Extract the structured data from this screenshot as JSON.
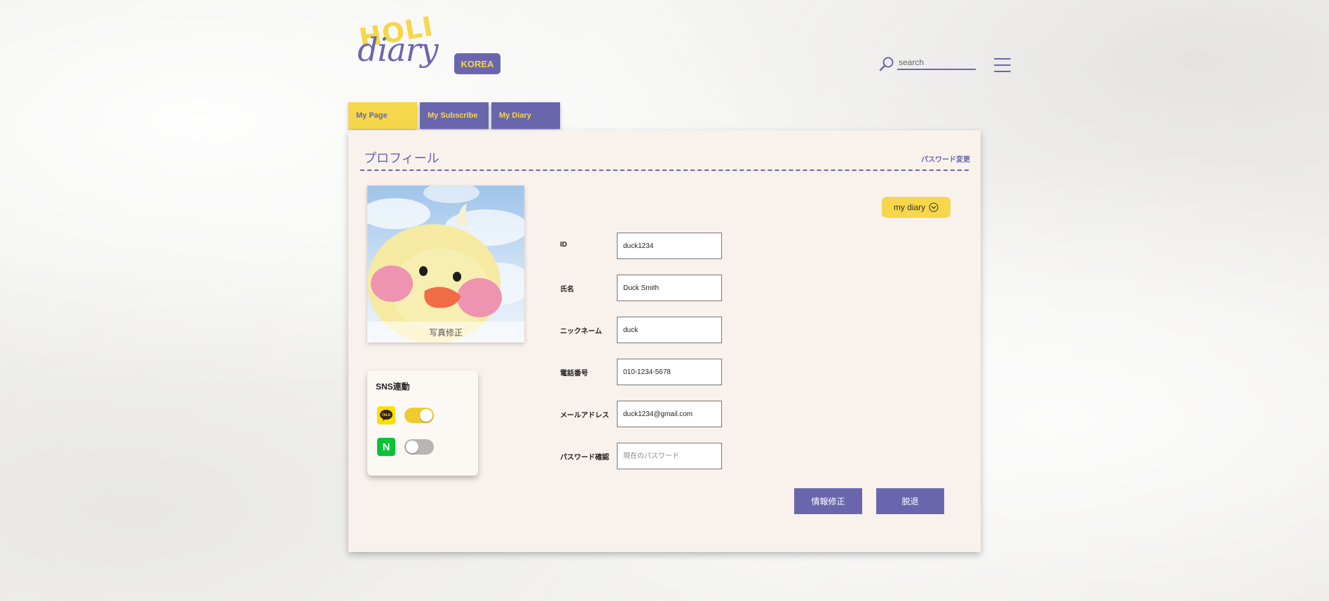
{
  "brand": {
    "logo_top": "HOLI",
    "logo_bottom": "diary",
    "region": "KOREA"
  },
  "search": {
    "placeholder": "search",
    "value": ""
  },
  "tabs": [
    {
      "label": "My Page",
      "active": true
    },
    {
      "label": "My Subscribe",
      "active": false
    },
    {
      "label": "My Diary",
      "active": false
    }
  ],
  "profile": {
    "title": "プロフィール",
    "password_change": "パスワード変更",
    "photo_edit": "写真修正",
    "diary_button": "my diary"
  },
  "sns": {
    "title": "SNS連動",
    "kakao_icon_text": "TALK",
    "naver_icon_text": "N",
    "kakao_linked": true,
    "naver_linked": false
  },
  "form": {
    "fields": [
      {
        "label": "ID",
        "value": "duck1234",
        "placeholder": ""
      },
      {
        "label": "氏名",
        "value": "Duck Smith",
        "placeholder": ""
      },
      {
        "label": "ニックネーム",
        "value": "duck",
        "placeholder": ""
      },
      {
        "label": "電話番号",
        "value": "010-1234-5678",
        "placeholder": ""
      },
      {
        "label": "メールアドレス",
        "value": "duck1234@gmail.com",
        "placeholder": ""
      },
      {
        "label": "パスワード確認",
        "value": "",
        "placeholder": "現在のパスワード"
      }
    ],
    "edit_button": "情報修正",
    "withdraw_button": "脱退"
  },
  "colors": {
    "purple": "#6a66ae",
    "yellow": "#f6d64a",
    "panel_bg": "#f9f1ec"
  }
}
